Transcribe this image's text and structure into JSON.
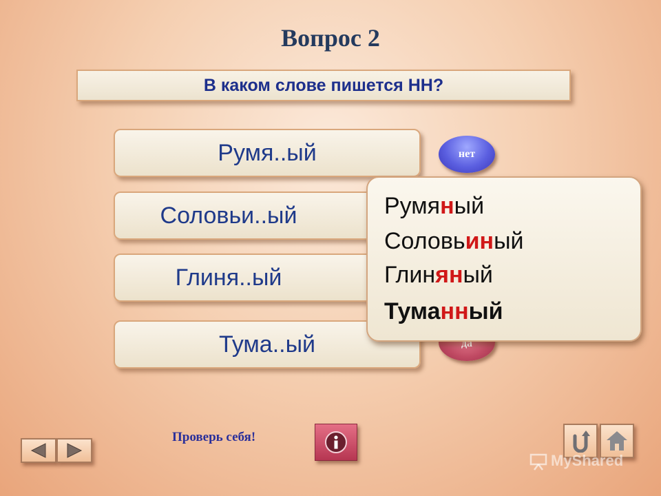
{
  "title": "Вопрос 2",
  "question": "В каком слове пишется НН?",
  "options": [
    {
      "label": "Румя..ый"
    },
    {
      "label": "Соловьи..ый"
    },
    {
      "label": "Глиня..ый"
    },
    {
      "label": "Тума..ый"
    }
  ],
  "answers": {
    "no": "нет",
    "yes": "да"
  },
  "popup": {
    "lines": [
      {
        "prefix": "Румя",
        "highlight": "н",
        "suffix": "ый"
      },
      {
        "prefix": "Соловь",
        "highlight": "ин",
        "suffix": "ый"
      },
      {
        "prefix": "Глин",
        "highlight": "ян",
        "suffix": "ый"
      },
      {
        "prefix": "Тума",
        "highlight": "нн",
        "suffix": "ый"
      }
    ]
  },
  "footer": {
    "check_label": "Проверь себя!"
  },
  "watermark": "MyShared",
  "colors": {
    "highlight": "#d01818",
    "text_blue": "#1f3a8a",
    "no_button": "#5b5fe0",
    "yes_button": "#c04a63"
  },
  "icons": [
    "info-icon",
    "arrow-left-icon",
    "arrow-right-icon",
    "return-icon",
    "home-icon"
  ]
}
